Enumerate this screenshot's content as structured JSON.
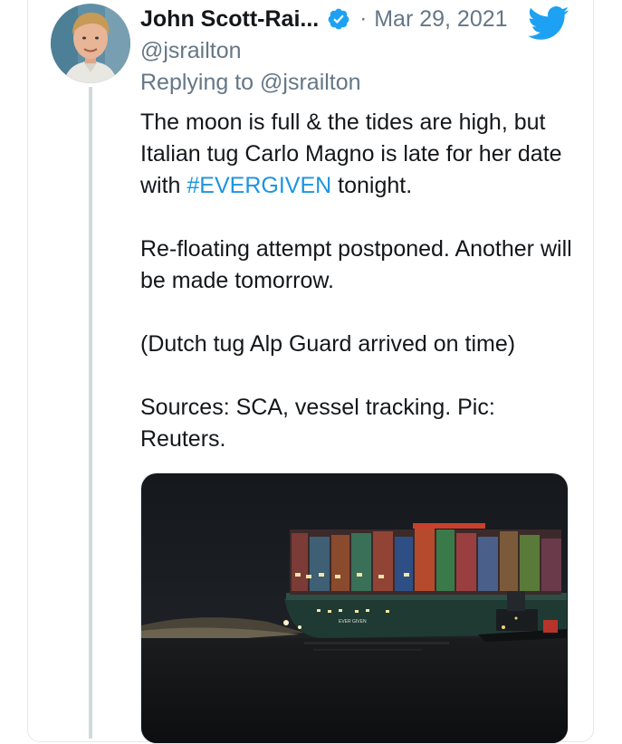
{
  "tweet": {
    "author_name": "John Scott-Rai...",
    "handle": "@jsrailton",
    "date": "Mar 29, 2021",
    "separator": "·",
    "reply_prefix": "Replying to ",
    "reply_to": "@jsrailton",
    "body": {
      "line1_before": "The moon is full & the tides are high, but Italian tug Carlo Magno is late for her date with ",
      "hashtag": "#EVERGIVEN",
      "line1_after": " tonight.",
      "para2": "Re-floating attempt postponed. Another will be made tomorrow.",
      "para3": "(Dutch tug Alp Guard arrived on time)",
      "para4": "Sources: SCA, vessel tracking. Pic: Reuters."
    },
    "media": {
      "ship_name": "EVER GIVEN"
    }
  },
  "colors": {
    "link": "#1b95e0",
    "verified": "#1da1f2",
    "twitter_brand": "#1da1f2",
    "text": "#14171a",
    "muted": "#657786"
  },
  "icons": [
    "avatar",
    "verified-badge-icon",
    "twitter-bird-icon"
  ]
}
